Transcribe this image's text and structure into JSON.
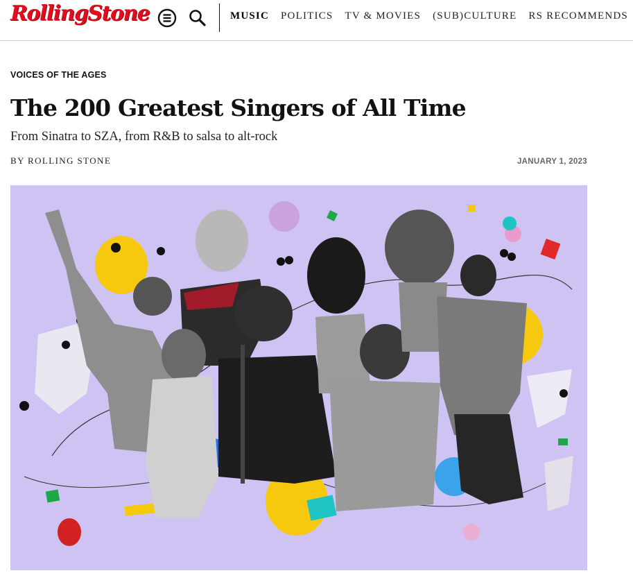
{
  "header": {
    "logo": "RollingStone",
    "menu_icon": "menu-icon",
    "search_icon": "search-icon",
    "nav": [
      {
        "label": "MUSIC",
        "active": true
      },
      {
        "label": "POLITICS",
        "active": false
      },
      {
        "label": "TV & MOVIES",
        "active": false
      },
      {
        "label": "(SUB)CULTURE",
        "active": false
      },
      {
        "label": "RS RECOMMENDS",
        "active": false
      }
    ]
  },
  "article": {
    "kicker": "VOICES OF THE AGES",
    "title": "The 200 Greatest Singers of All Time",
    "dek": "From Sinatra to SZA, from R&B to salsa to alt-rock",
    "byline": "BY ROLLING STONE",
    "date": "JANUARY 1, 2023"
  },
  "hero": {
    "background": "#cfc3f4",
    "accents": [
      "#f6c90e",
      "#e02a2a",
      "#2f6fe0",
      "#1fa84a",
      "#20c4c4",
      "#111111"
    ]
  },
  "colors": {
    "brand": "#e00d1f",
    "text": "#111111",
    "muted": "#666666",
    "rule": "#cfcfcf"
  }
}
